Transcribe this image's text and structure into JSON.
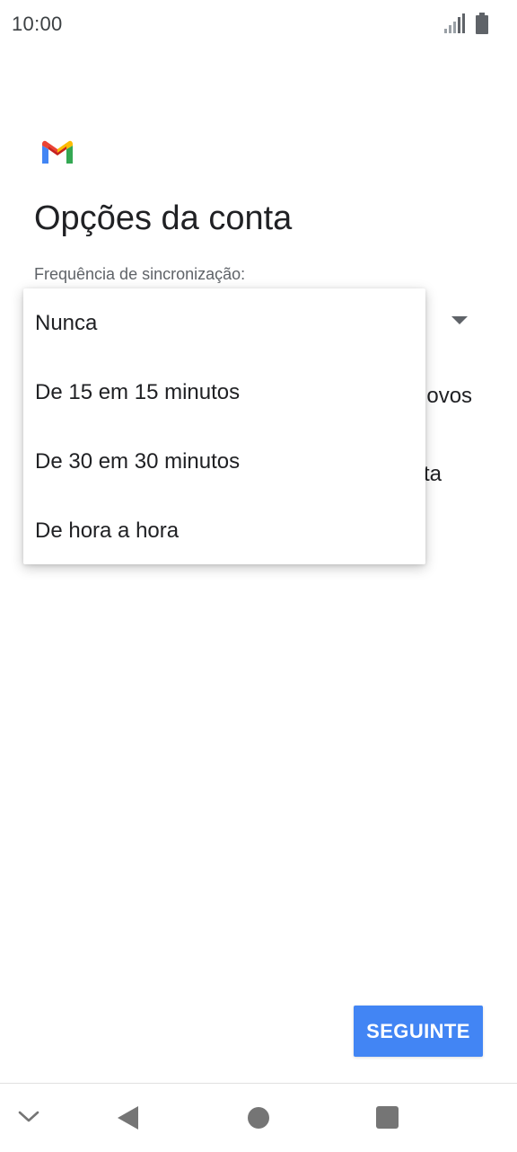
{
  "status_bar": {
    "time": "10:00",
    "icons": [
      "signal-icon",
      "battery-icon"
    ]
  },
  "header": {
    "logo": "gmail-logo",
    "title": "Opções da conta"
  },
  "form": {
    "sync_frequency_label": "Frequência de sincronização:",
    "obscured_fragments": [
      "novos",
      "ta"
    ]
  },
  "sync_menu": {
    "options": [
      {
        "label": "Nunca"
      },
      {
        "label": "De 15 em 15 minutos"
      },
      {
        "label": "De 30 em 30 minutos"
      },
      {
        "label": "De hora a hora"
      }
    ]
  },
  "footer": {
    "next_label": "SEGUINTE"
  },
  "nav_bar": {
    "icons": [
      "chevron-down-icon",
      "back-icon",
      "home-icon",
      "recents-icon"
    ]
  },
  "colors": {
    "accent": "#4285f4",
    "text_primary": "#202124",
    "text_secondary": "#5f6368",
    "nav_icon": "#757575"
  }
}
